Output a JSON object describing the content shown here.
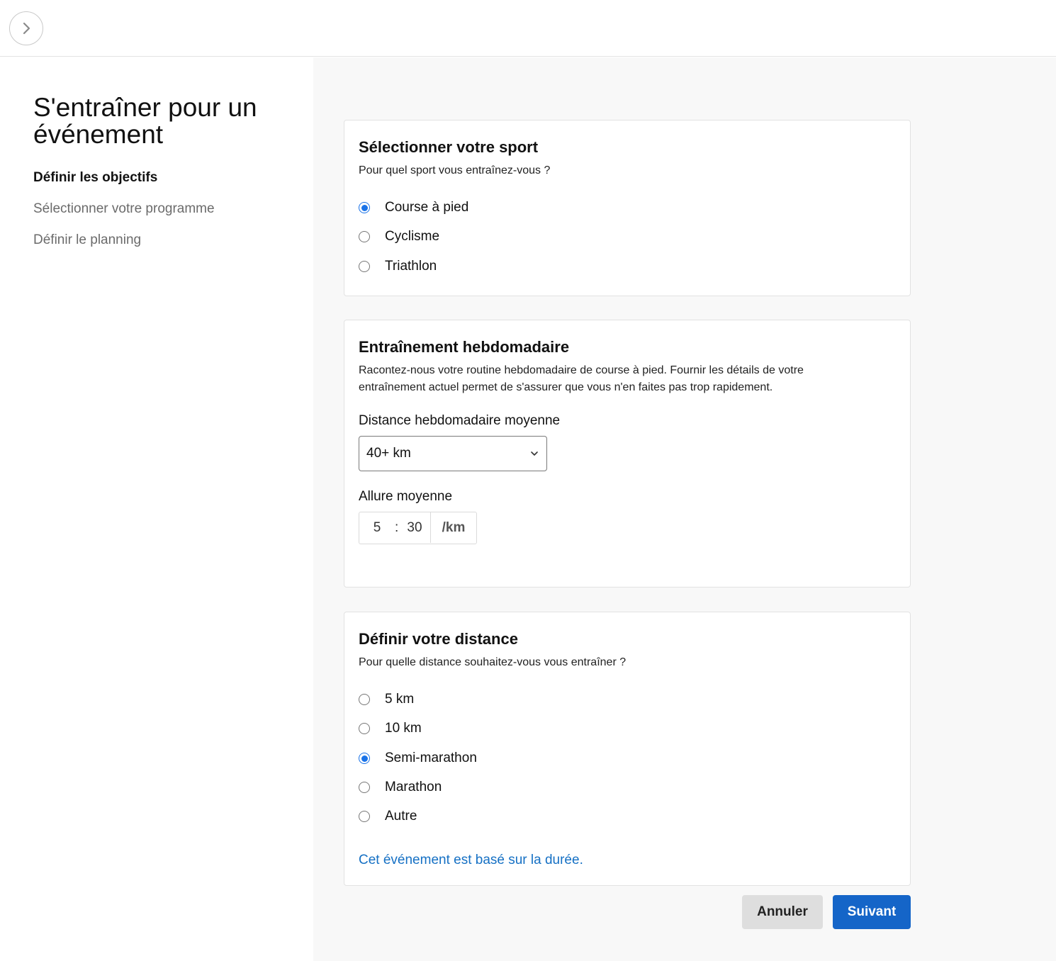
{
  "page": {
    "title": "S'entraîner pour un événement"
  },
  "steps": [
    {
      "label": "Définir les objectifs"
    },
    {
      "label": "Sélectionner votre programme"
    },
    {
      "label": "Définir le planning"
    }
  ],
  "sport": {
    "title": "Sélectionner votre sport",
    "question": "Pour quel sport vous entraînez-vous ?",
    "options": [
      {
        "label": "Course à pied",
        "checked": true
      },
      {
        "label": "Cyclisme",
        "checked": false
      },
      {
        "label": "Triathlon",
        "checked": false
      }
    ]
  },
  "weekly": {
    "title": "Entraînement hebdomadaire",
    "description": "Racontez-nous votre routine hebdomadaire de course à pied. Fournir les détails de votre entraînement actuel permet de s'assurer que vous n'en faites pas trop rapidement.",
    "distance_label": "Distance hebdomadaire moyenne",
    "distance_value": "40+ km",
    "pace_label": "Allure moyenne",
    "pace_minutes": "5",
    "pace_separator": ":",
    "pace_seconds": "30",
    "pace_unit": "/km"
  },
  "distance": {
    "title": "Définir votre distance",
    "question": "Pour quelle distance souhaitez-vous vous entraîner ?",
    "options": [
      {
        "label": "5 km",
        "checked": false
      },
      {
        "label": "10 km",
        "checked": false
      },
      {
        "label": "Semi-marathon",
        "checked": true
      },
      {
        "label": "Marathon",
        "checked": false
      },
      {
        "label": "Autre",
        "checked": false
      }
    ],
    "duration_link": "Cet événement est basé sur la durée."
  },
  "actions": {
    "cancel_label": "Annuler",
    "next_label": "Suivant"
  },
  "colors": {
    "accent": "#1a73e8",
    "primary_button": "#1565c8",
    "link": "#1570c4",
    "main_background": "#f8f8f8"
  }
}
